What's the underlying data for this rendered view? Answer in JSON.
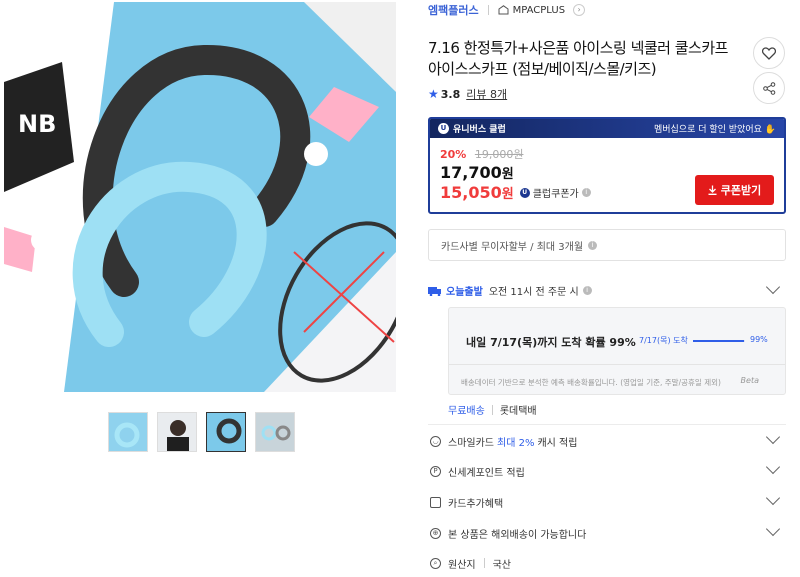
{
  "seller": {
    "name": "엠팩플러스",
    "store": "MPACPLUS"
  },
  "product": {
    "title": "7.16 한정특가+사은품 아이스링 넥쿨러 쿨스카프 아이스스카프 (점보/베이직/스몰/키즈)",
    "rating": "3.8",
    "reviews": "리뷰 8개"
  },
  "price": {
    "club_label": "유니버스 클럽",
    "club_badge": "U",
    "club_promo": "멤버십으로 더 할인 받았어요",
    "discount": "20%",
    "original": "19,000원",
    "sale": "17,700",
    "sale_unit": "원",
    "club_price": "15,050",
    "club_unit": "원",
    "club_coupon": "클럽쿠폰가",
    "coupon_button": "쿠폰받기"
  },
  "card_benefit": "카드사별 무이자할부 / 최대 3개월",
  "delivery": {
    "today_label": "오늘출발",
    "cutoff": "오전 11시 전 주문 시",
    "forecast_main": "내일 7/17(목)까지 도착 확률 99%",
    "forecast_date": "7/17(목) 도착",
    "forecast_pct": "99%",
    "forecast_value": 0.99,
    "note": "배송데이터 기반으로 분석한 예측 배송확률입니다. (영업일 기준, 주말/공휴일 제외)",
    "beta": "Beta",
    "free": "무료배송",
    "carrier": "롯데택배"
  },
  "options": {
    "smile_pre": "스마일카드",
    "smile_hl": "최대 2%",
    "smile_post": "캐시 적립",
    "point": "신세계포인트 적립",
    "card_extra": "카드추가혜택",
    "overseas": "본 상품은 해외배송이 가능합니다",
    "origin_label": "원산지",
    "origin_value": "국산"
  },
  "icons": [
    "heart-icon",
    "share-icon",
    "star-icon",
    "download-icon",
    "chevron-down-icon",
    "truck-icon",
    "globe-icon",
    "search-icon"
  ],
  "colors": {
    "accent": "#2f5ee8",
    "sale_red": "#f03c3c",
    "coupon_red": "#e31b1b",
    "club_navy": "#1f3d99"
  }
}
